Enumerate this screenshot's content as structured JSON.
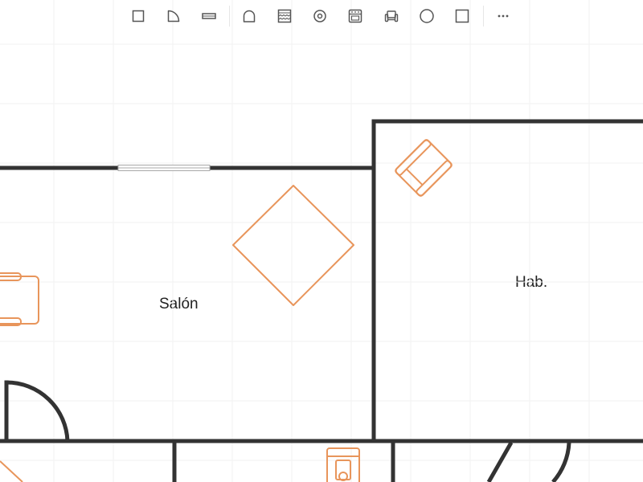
{
  "toolbar": {
    "tools": [
      {
        "id": "wall",
        "icon": "square-wall-icon"
      },
      {
        "id": "door",
        "icon": "door-arc-icon"
      },
      {
        "id": "window",
        "icon": "window-icon"
      },
      {
        "id": "arch",
        "icon": "arch-icon"
      },
      {
        "id": "stairs",
        "icon": "stairs-icon"
      },
      {
        "id": "sink",
        "icon": "sink-circle-icon"
      },
      {
        "id": "stove",
        "icon": "stove-icon"
      },
      {
        "id": "sofa",
        "icon": "sofa-icon"
      },
      {
        "id": "circle",
        "icon": "circle-icon"
      },
      {
        "id": "rectangle",
        "icon": "rectangle-icon"
      },
      {
        "id": "more",
        "icon": "more-dots-icon"
      }
    ]
  },
  "rooms": [
    {
      "id": "salon",
      "label": "Salón"
    },
    {
      "id": "hab",
      "label": "Hab."
    }
  ],
  "colors": {
    "wall": "#333333",
    "furniture": "#e8955b",
    "grid": "#f3f3f3",
    "toolbar_icon": "#555555",
    "window": "#aaaaaa"
  }
}
